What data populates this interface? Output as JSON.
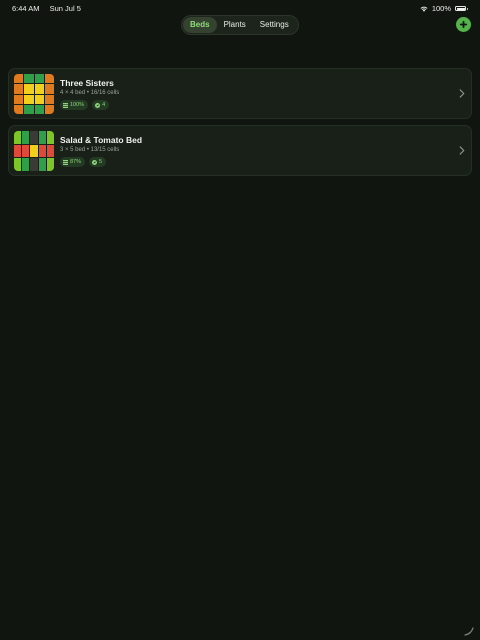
{
  "status": {
    "time": "6:44 AM",
    "date": "Sun Jul 5",
    "battery": "100%",
    "icons": [
      "wifi-icon",
      "battery-icon"
    ]
  },
  "nav": {
    "tabs": [
      {
        "label": "Beds",
        "active": true
      },
      {
        "label": "Plants",
        "active": false
      },
      {
        "label": "Settings",
        "active": false
      }
    ],
    "add_icon": "plus-icon"
  },
  "colors": {
    "orange": "#e07a1e",
    "green": "#2fa049",
    "yellow": "#f2cf1b",
    "lime": "#7cc628",
    "red": "#e0483a",
    "dark_cell": "#3a3a36",
    "accent": "#8fdc7a"
  },
  "beds": [
    {
      "name": "Three Sisters",
      "meta": "4 × 4 bed • 16/16 cells",
      "fill_badge": "100%",
      "plants_badge": "4",
      "grid": {
        "cols": 4,
        "rows": 4,
        "cells": [
          "orange",
          "green",
          "green",
          "orange",
          "orange",
          "yellow",
          "yellow",
          "orange",
          "orange",
          "yellow",
          "yellow",
          "orange",
          "orange",
          "green",
          "green",
          "orange"
        ]
      }
    },
    {
      "name": "Salad & Tomato Bed",
      "meta": "3 × 5 bed • 13/15 cells",
      "fill_badge": "87%",
      "plants_badge": "5",
      "grid": {
        "cols": 5,
        "rows": 3,
        "cells": [
          "lime",
          "green",
          "dark_cell",
          "green",
          "lime",
          "red",
          "red",
          "yellow",
          "red",
          "red",
          "lime",
          "green",
          "dark_cell",
          "green",
          "lime"
        ]
      }
    }
  ]
}
